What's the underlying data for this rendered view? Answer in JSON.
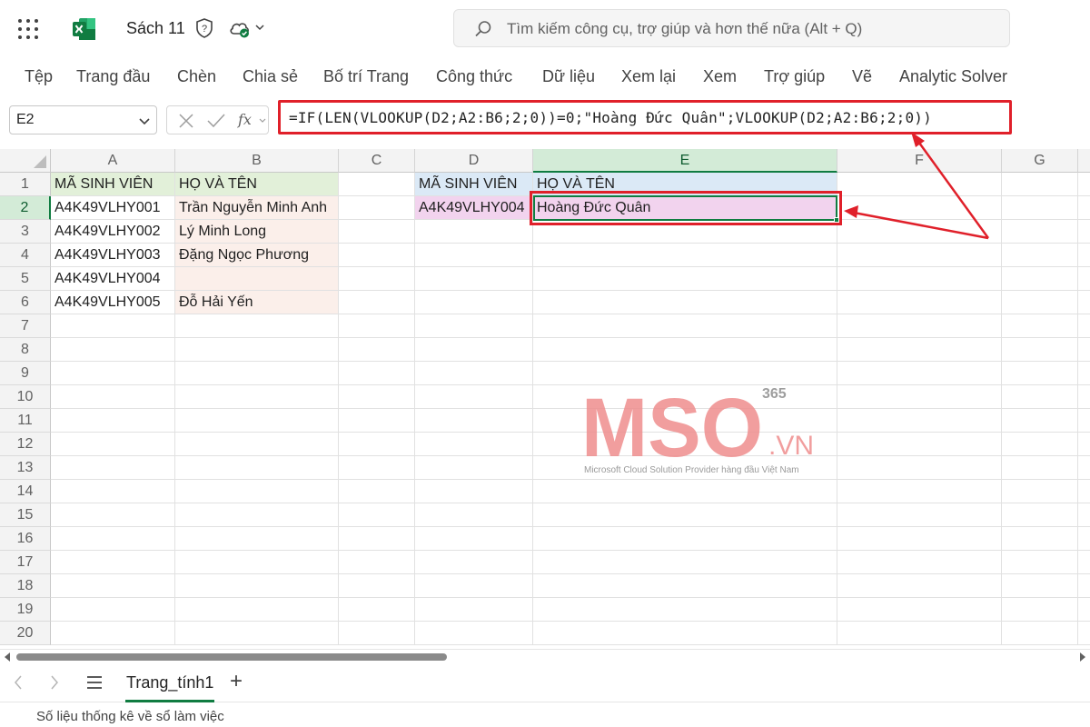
{
  "titlebar": {
    "doc_title": "Sách 11",
    "search_placeholder": "Tìm kiếm công cụ, trợ giúp và hơn thế nữa (Alt + Q)",
    "brand_color": "#107c41"
  },
  "ribbon": {
    "tabs": [
      "Tệp",
      "Trang đầu",
      "Chèn",
      "Chia sẻ",
      "Bố trí Trang",
      "Công thức",
      "Dữ liệu",
      "Xem lại",
      "Xem",
      "Trợ giúp",
      "Vẽ",
      "Analytic Solver"
    ]
  },
  "formula_bar": {
    "name_box": "E2",
    "fx_label": "fx",
    "formula": "=IF(LEN(VLOOKUP(D2;A2:B6;2;0))=0;\"Hoàng Đức Quân\";VLOOKUP(D2;A2:B6;2;0))"
  },
  "grid": {
    "columns": [
      "A",
      "B",
      "C",
      "D",
      "E",
      "F",
      "G"
    ],
    "rows": [
      "1",
      "2",
      "3",
      "4",
      "5",
      "6",
      "7",
      "8",
      "9",
      "10",
      "11",
      "12",
      "13",
      "14",
      "15",
      "16",
      "17",
      "18",
      "19",
      "20"
    ],
    "active_cell": "E2",
    "cells": {
      "A1": "MÃ SINH VIÊN",
      "B1": "HỌ VÀ TÊN",
      "A2": "A4K49VLHY001",
      "B2": "Trần Nguyễn Minh Anh",
      "A3": "A4K49VLHY002",
      "B3": "Lý Minh Long",
      "A4": "A4K49VLHY003",
      "B4": "Đặng Ngọc Phương",
      "A5": "A4K49VLHY004",
      "B5": "",
      "A6": "A4K49VLHY005",
      "B6": "Đỗ Hải Yến",
      "D1": "MÃ SINH VIÊN",
      "E1": "HỌ VÀ TÊN",
      "D2": "A4K49VLHY004",
      "E2": "Hoàng Đức Quân"
    },
    "fill_colors": {
      "header_green": "#e2f0d9",
      "data_pink": "#fbefea",
      "lookup_blue": "#dbe9f6",
      "result_mauve": "#f2d3ee",
      "highlight_red": "#e0202a"
    }
  },
  "watermark": {
    "logo_text": "MSO",
    "superscript": "365",
    "suffix": ".VN",
    "caption": "Microsoft Cloud Solution Provider hàng đầu Việt Nam"
  },
  "sheets": {
    "active": "Trang_tính1",
    "add_label": "+"
  },
  "status": {
    "text": "Số liệu thống kê về sổ làm việc"
  }
}
